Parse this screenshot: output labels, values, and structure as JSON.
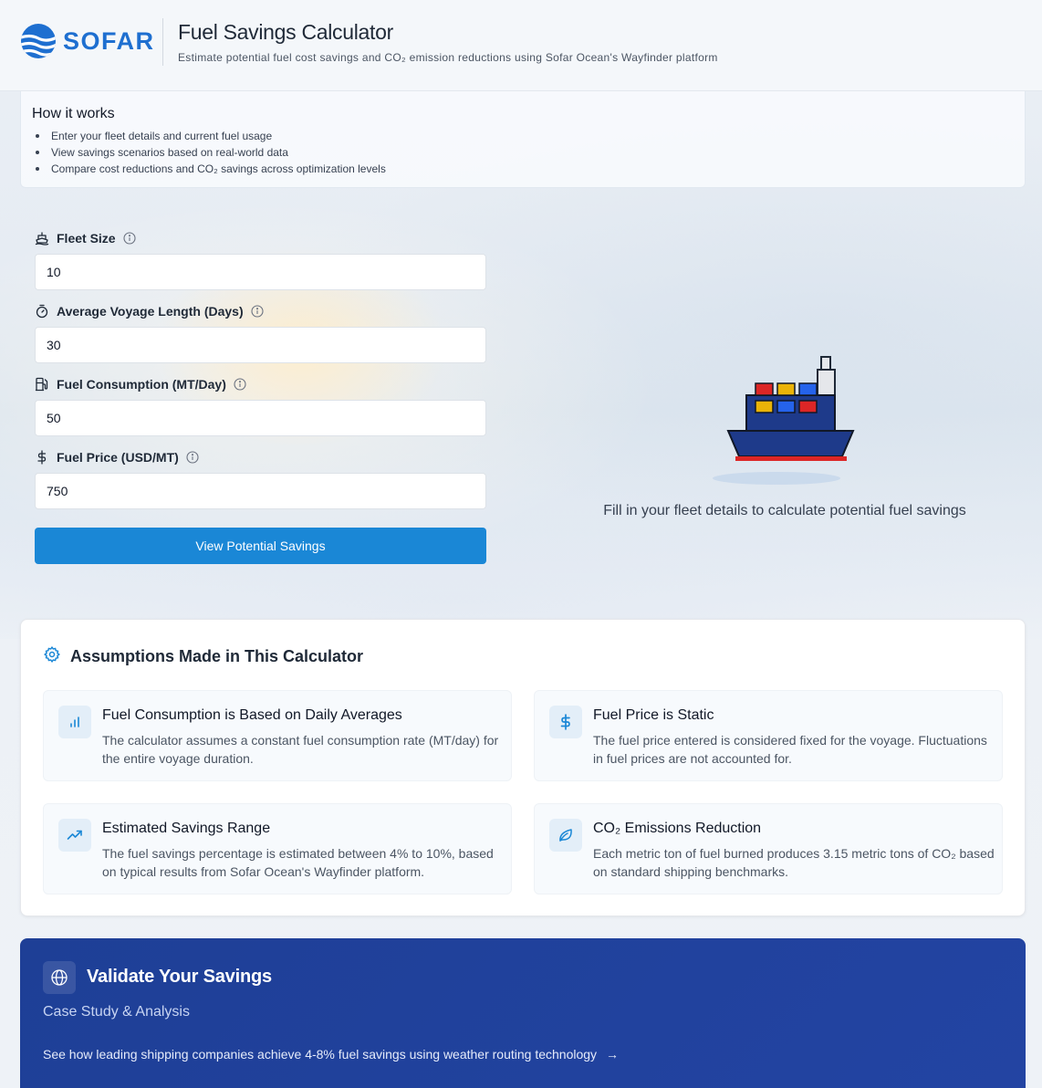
{
  "brand": {
    "name": "SOFAR",
    "color": "#1e6fd0"
  },
  "header": {
    "title": "Fuel Savings Calculator",
    "subtitle": "Estimate potential fuel cost savings and CO₂ emission reductions using Sofar Ocean's Wayfinder platform"
  },
  "how_it_works": {
    "title": "How it works",
    "items": [
      "Enter your fleet details and current fuel usage",
      "View savings scenarios based on real-world data",
      "Compare cost reductions and CO₂ savings across optimization levels"
    ]
  },
  "form": {
    "fields": [
      {
        "label": "Fleet Size",
        "value": "10",
        "icon": "ship-icon"
      },
      {
        "label": "Average Voyage Length (Days)",
        "value": "30",
        "icon": "timer-icon"
      },
      {
        "label": "Fuel Consumption (MT/Day)",
        "value": "50",
        "icon": "fuel-pump-icon"
      },
      {
        "label": "Fuel Price (USD/MT)",
        "value": "750",
        "icon": "dollar-icon"
      }
    ],
    "submit_label": "View Potential Savings",
    "accent": "#1a87d6"
  },
  "results": {
    "placeholder": "Fill in your fleet details to calculate potential fuel savings"
  },
  "assumptions": {
    "title": "Assumptions Made in This Calculator",
    "cards": [
      {
        "icon": "bar-chart-icon",
        "title": "Fuel Consumption is Based on Daily Averages",
        "desc": "The calculator assumes a constant fuel consumption rate (MT/day) for the entire voyage duration."
      },
      {
        "icon": "dollar-icon",
        "title": "Fuel Price is Static",
        "desc": "The fuel price entered is considered fixed for the voyage. Fluctuations in fuel prices are not accounted for."
      },
      {
        "icon": "trending-up-icon",
        "title": "Estimated Savings Range",
        "desc": "The fuel savings percentage is estimated between 4% to 10%, based on typical results from Sofar Ocean's Wayfinder platform."
      },
      {
        "icon": "leaf-icon",
        "title": "CO₂ Emissions Reduction",
        "desc": "Each metric ton of fuel burned produces 3.15 metric tons of CO₂ based on standard shipping benchmarks."
      }
    ]
  },
  "validate": {
    "title": "Validate Your Savings",
    "subtitle": "Case Study & Analysis",
    "link_text": "See how leading shipping companies achieve 4-8% fuel savings using weather routing technology",
    "link_arrow": "→",
    "background": "#1e3f96"
  }
}
